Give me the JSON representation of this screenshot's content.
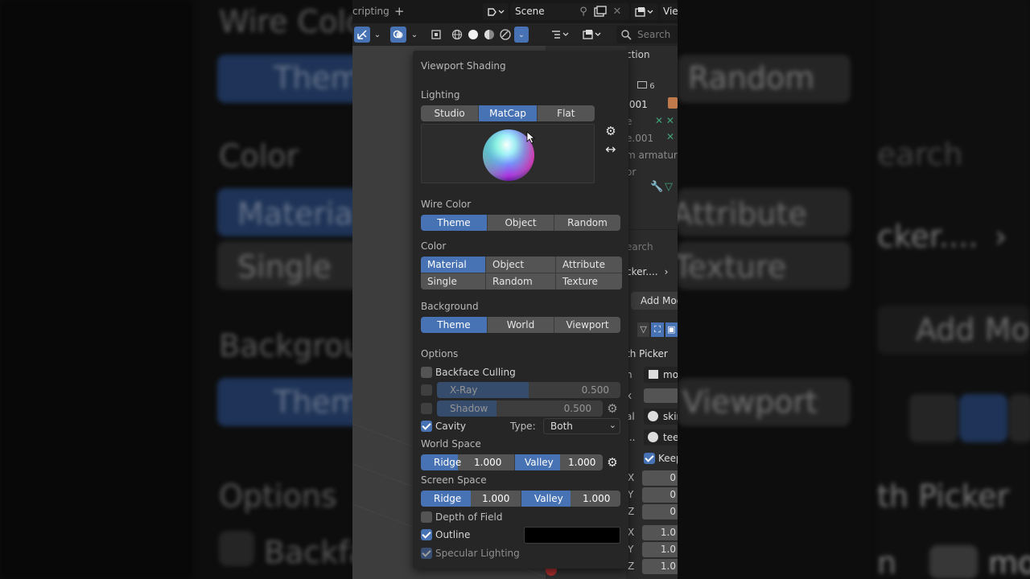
{
  "background_blur": {
    "wire_color": "Wire Colo",
    "theme_1": "Them",
    "random": "Random",
    "color": "Color",
    "material": "Material",
    "single": "Single",
    "attribute": "Attribute",
    "texture": "Texture",
    "search": "earch",
    "picker": "cker....",
    "background": "Backgrou",
    "theme_2": "Them",
    "viewport": "Viewport",
    "add_mod": "Add Mo",
    "options": "Options",
    "backface": "Backfa",
    "th_picker": "th Picker",
    "n": "n",
    "mo": "mo"
  },
  "header": {
    "workspace_tab": "cripting",
    "add_tab": "+",
    "scene_name": "Scene",
    "view_layer": "Vie"
  },
  "toolbar": {
    "search_placeholder": "Search"
  },
  "popover": {
    "title": "Viewport Shading",
    "lighting": {
      "label": "Lighting",
      "options": [
        "Studio",
        "MatCap",
        "Flat"
      ],
      "selected": "MatCap"
    },
    "wire_color": {
      "label": "Wire Color",
      "options": [
        "Theme",
        "Object",
        "Random"
      ],
      "selected": "Theme"
    },
    "color": {
      "label": "Color",
      "options": [
        "Material",
        "Object",
        "Attribute",
        "Single",
        "Random",
        "Texture"
      ],
      "selected": "Material"
    },
    "background": {
      "label": "Background",
      "options": [
        "Theme",
        "World",
        "Viewport"
      ],
      "selected": "Theme"
    },
    "options": {
      "label": "Options",
      "backface_culling": "Backface Culling",
      "xray": {
        "label": "X-Ray",
        "value": "0.500"
      },
      "shadow": {
        "label": "Shadow",
        "value": "0.500"
      },
      "cavity": "Cavity",
      "type_label": "Type:",
      "type_value": "Both",
      "world_space": "World Space",
      "ws_ridge_label": "Ridge",
      "ws_ridge_value": "1.000",
      "ws_valley_label": "Valley",
      "ws_valley_value": "1.000",
      "screen_space": "Screen Space",
      "ss_ridge_label": "Ridge",
      "ss_ridge_value": "1.000",
      "ss_valley_label": "Valley",
      "ss_valley_value": "1.000",
      "depth_of_field": "Depth of Field",
      "outline": "Outline",
      "specular": "Specular Lighting"
    }
  },
  "right_panel": {
    "ction": "ction",
    "count": "6",
    "item1": ".001",
    "item2": "e",
    "item3": "e.001",
    "item4": "m armature",
    "item5": "or",
    "search": "earch",
    "picker": "cker....",
    "add_mod": "Add Mod",
    "th_picker": "th Picker",
    "n": "n",
    "mo": "mo",
    "x": "x",
    "al": "al",
    "ski": "skir",
    "dots": "...",
    "tee": "tee",
    "keep": "Keep",
    "axes": [
      "X",
      "Y",
      "Z",
      "X",
      "Y",
      "Z"
    ],
    "vals": [
      "0",
      "0",
      "0",
      "1.0",
      "1.0",
      "1.0"
    ]
  },
  "colors": {
    "accent": "#4772b3",
    "panel": "#262626",
    "button": "#545454"
  }
}
